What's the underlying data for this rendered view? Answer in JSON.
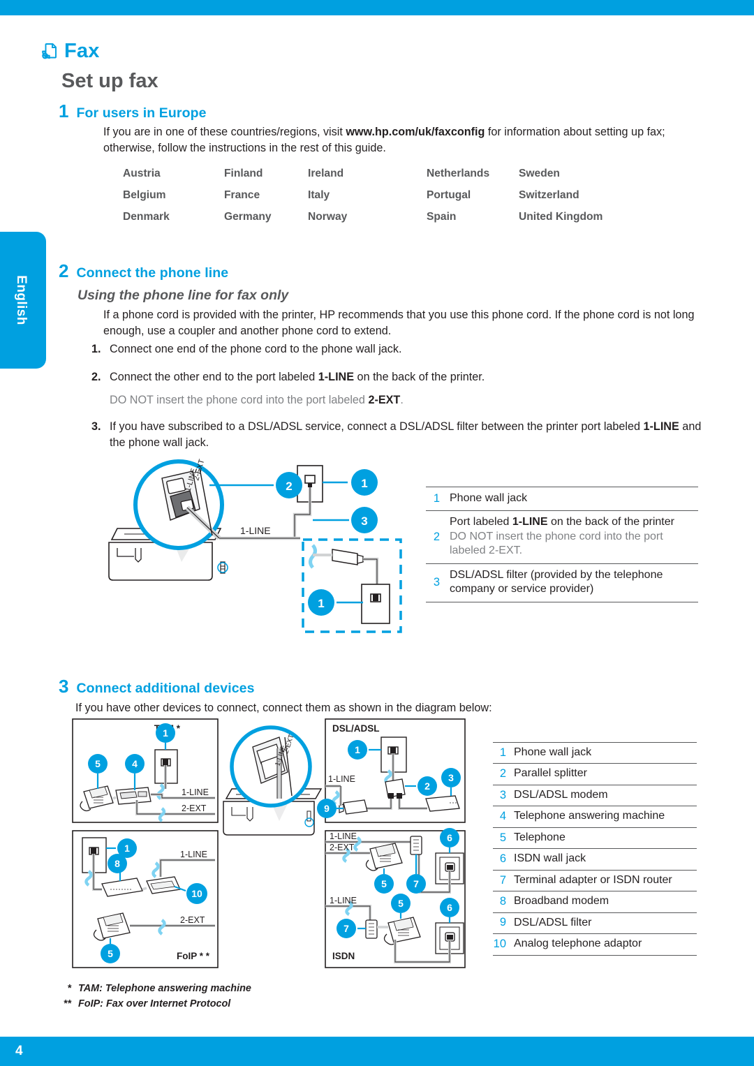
{
  "colors": {
    "brand_blue": "#00a0e0",
    "heading_grey": "#58595b",
    "body": "#231f20",
    "muted": "#808285"
  },
  "chrome": {
    "page_number": "4",
    "language_tab": "English"
  },
  "header": {
    "icon": "fax-icon",
    "title": "Fax",
    "subtitle": "Set up fax"
  },
  "sections": {
    "s1": {
      "number": "1",
      "title": "For users in Europe",
      "paragraph_pre": "If you are in one of these countries/regions, visit ",
      "paragraph_url": "www.hp.com/uk/faxconfig",
      "paragraph_post": " for information about setting up fax; otherwise, follow the instructions in the rest of this guide.",
      "countries": [
        "Austria",
        "Finland",
        "Ireland",
        "Netherlands",
        "Sweden",
        "Belgium",
        "France",
        "Italy",
        "Portugal",
        "Switzerland",
        "Denmark",
        "Germany",
        "Norway",
        "Spain",
        "United Kingdom"
      ]
    },
    "s2": {
      "number": "2",
      "title": "Connect the phone line",
      "subheading": "Using the phone line for fax only",
      "paragraph": "If a phone cord is provided with the printer, HP recommends that you use this phone cord. If the phone cord is not long enough, use a coupler and another phone cord to extend.",
      "steps": [
        {
          "n": "1.",
          "pre": "Connect one end of the phone cord to the phone wall jack.",
          "bold": "",
          "post": ""
        },
        {
          "n": "2.",
          "pre": "Connect the other end to the port labeled ",
          "bold": "1-LINE",
          "post": " on the back of the printer."
        },
        {
          "n": "3.",
          "pre": "If you have subscribed to a DSL/ADSL service, connect a DSL/ADSL filter between the printer port labeled ",
          "bold": "1-LINE",
          "post": " and the phone wall jack."
        }
      ],
      "note_pre": "DO NOT insert the phone cord into the port labeled ",
      "note_bold": "2-EXT",
      "note_post": ".",
      "diagram": {
        "port_label": "1-LINE",
        "zoom_labels": [
          "1-LINE",
          "2-EXT"
        ],
        "callouts": [
          "1",
          "2",
          "3",
          "1"
        ]
      },
      "legend": [
        {
          "k": "1",
          "v": "Phone wall jack"
        },
        {
          "k": "2",
          "v_pre": "Port labeled ",
          "v_bold": "1-LINE",
          "v_post": " on the back of the printer",
          "v_note": "DO NOT insert the phone cord into the port labeled 2-EXT."
        },
        {
          "k": "3",
          "v": "DSL/ADSL filter (provided by the telephone company or service provider)"
        }
      ]
    },
    "s3": {
      "number": "3",
      "title": "Connect additional devices",
      "paragraph": "If you have other devices to connect, connect them as shown in the diagram below:",
      "panels": {
        "tam": {
          "label": "TAM *",
          "ports": [
            "1-LINE",
            "2-EXT"
          ],
          "callouts": [
            "5",
            "4",
            "1"
          ]
        },
        "foip": {
          "label": "FoIP * *",
          "ports": [
            "1-LINE",
            "2-EXT"
          ],
          "callouts": [
            "1",
            "8",
            "10",
            "5"
          ]
        },
        "printer": {
          "zoom_labels": [
            "1-LINE",
            "2-EXT"
          ]
        },
        "dsl": {
          "label": "DSL/ADSL",
          "ports": [
            "1-LINE"
          ],
          "callouts": [
            "1",
            "2",
            "3",
            "9"
          ]
        },
        "ta": {
          "ports": [
            "1-LINE",
            "2-EXT"
          ],
          "callouts": [
            "5",
            "7",
            "6"
          ]
        },
        "isdn": {
          "label": "ISDN",
          "ports": [
            "1-LINE"
          ],
          "callouts": [
            "7",
            "5",
            "6"
          ]
        }
      },
      "legend": [
        {
          "k": "1",
          "v": "Phone wall jack"
        },
        {
          "k": "2",
          "v": "Parallel splitter"
        },
        {
          "k": "3",
          "v": "DSL/ADSL modem"
        },
        {
          "k": "4",
          "v": "Telephone answering machine"
        },
        {
          "k": "5",
          "v": "Telephone"
        },
        {
          "k": "6",
          "v": "ISDN wall jack"
        },
        {
          "k": "7",
          "v": "Terminal adapter or ISDN router"
        },
        {
          "k": "8",
          "v": "Broadband modem"
        },
        {
          "k": "9",
          "v": "DSL/ADSL filter"
        },
        {
          "k": "10",
          "v": "Analog telephone adaptor"
        }
      ]
    }
  },
  "footnotes": [
    {
      "mark": "*",
      "text": "TAM: Telephone answering machine"
    },
    {
      "mark": "**",
      "text": "FoIP: Fax over Internet Protocol"
    }
  ]
}
